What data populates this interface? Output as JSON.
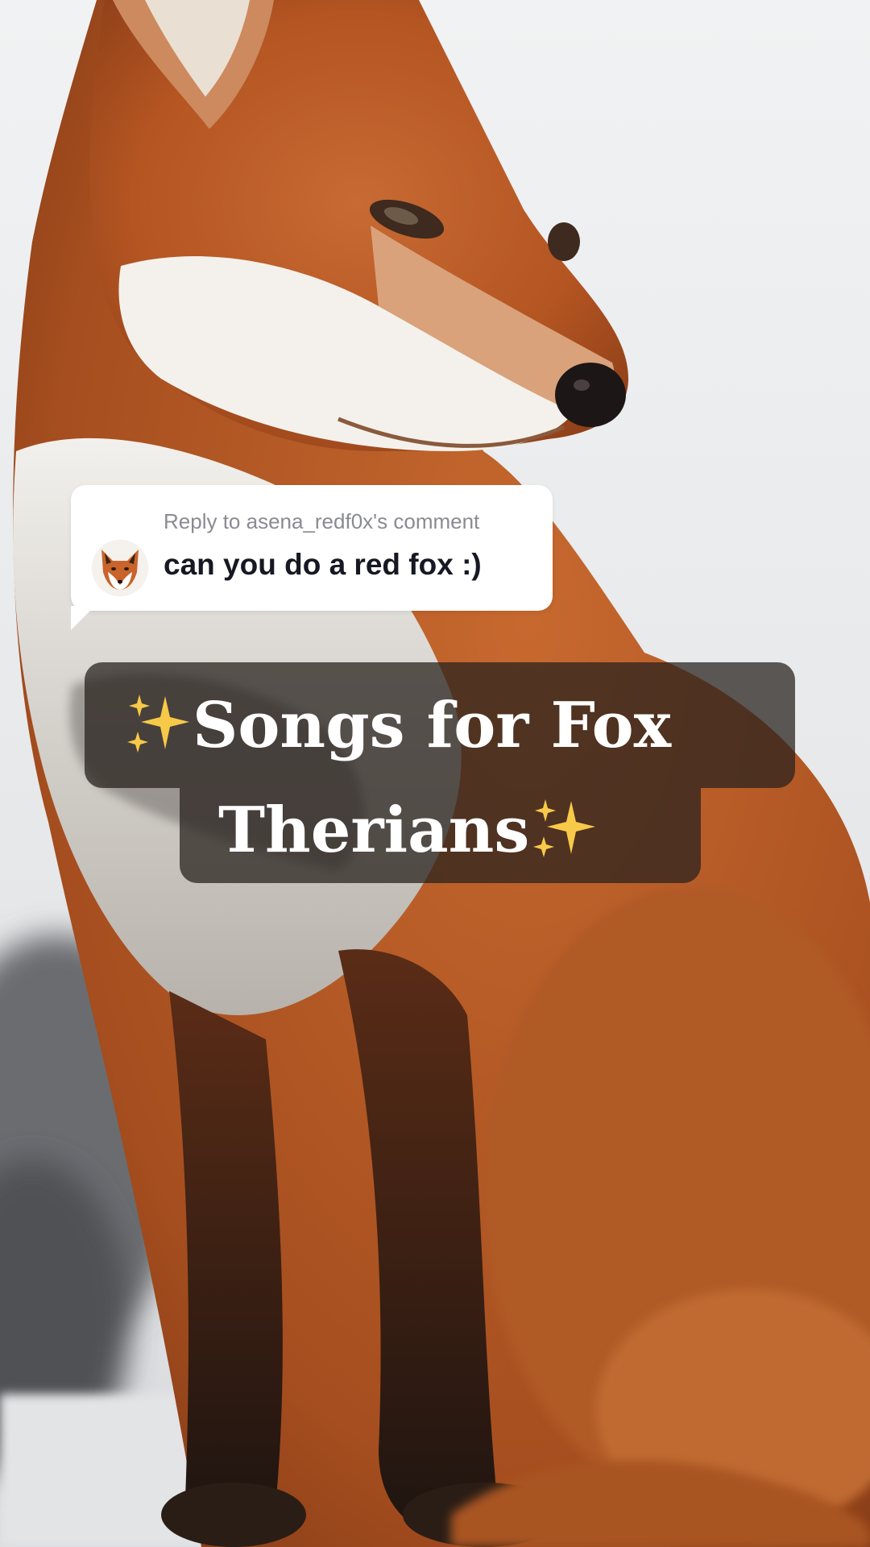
{
  "reply_sticker": {
    "header": "Reply to asena_redf0x's comment",
    "comment": "can you do a red fox :)",
    "avatar_icon": "fox-avatar-icon"
  },
  "caption": {
    "line1": "Songs for Fox",
    "line2": "Therians",
    "sparkle_icon": "sparkles-icon",
    "background": "#28221e"
  },
  "colors": {
    "fox_fur": "#c0602a",
    "snow_background": "#eef0f2",
    "sparkle": "#f7c948"
  }
}
